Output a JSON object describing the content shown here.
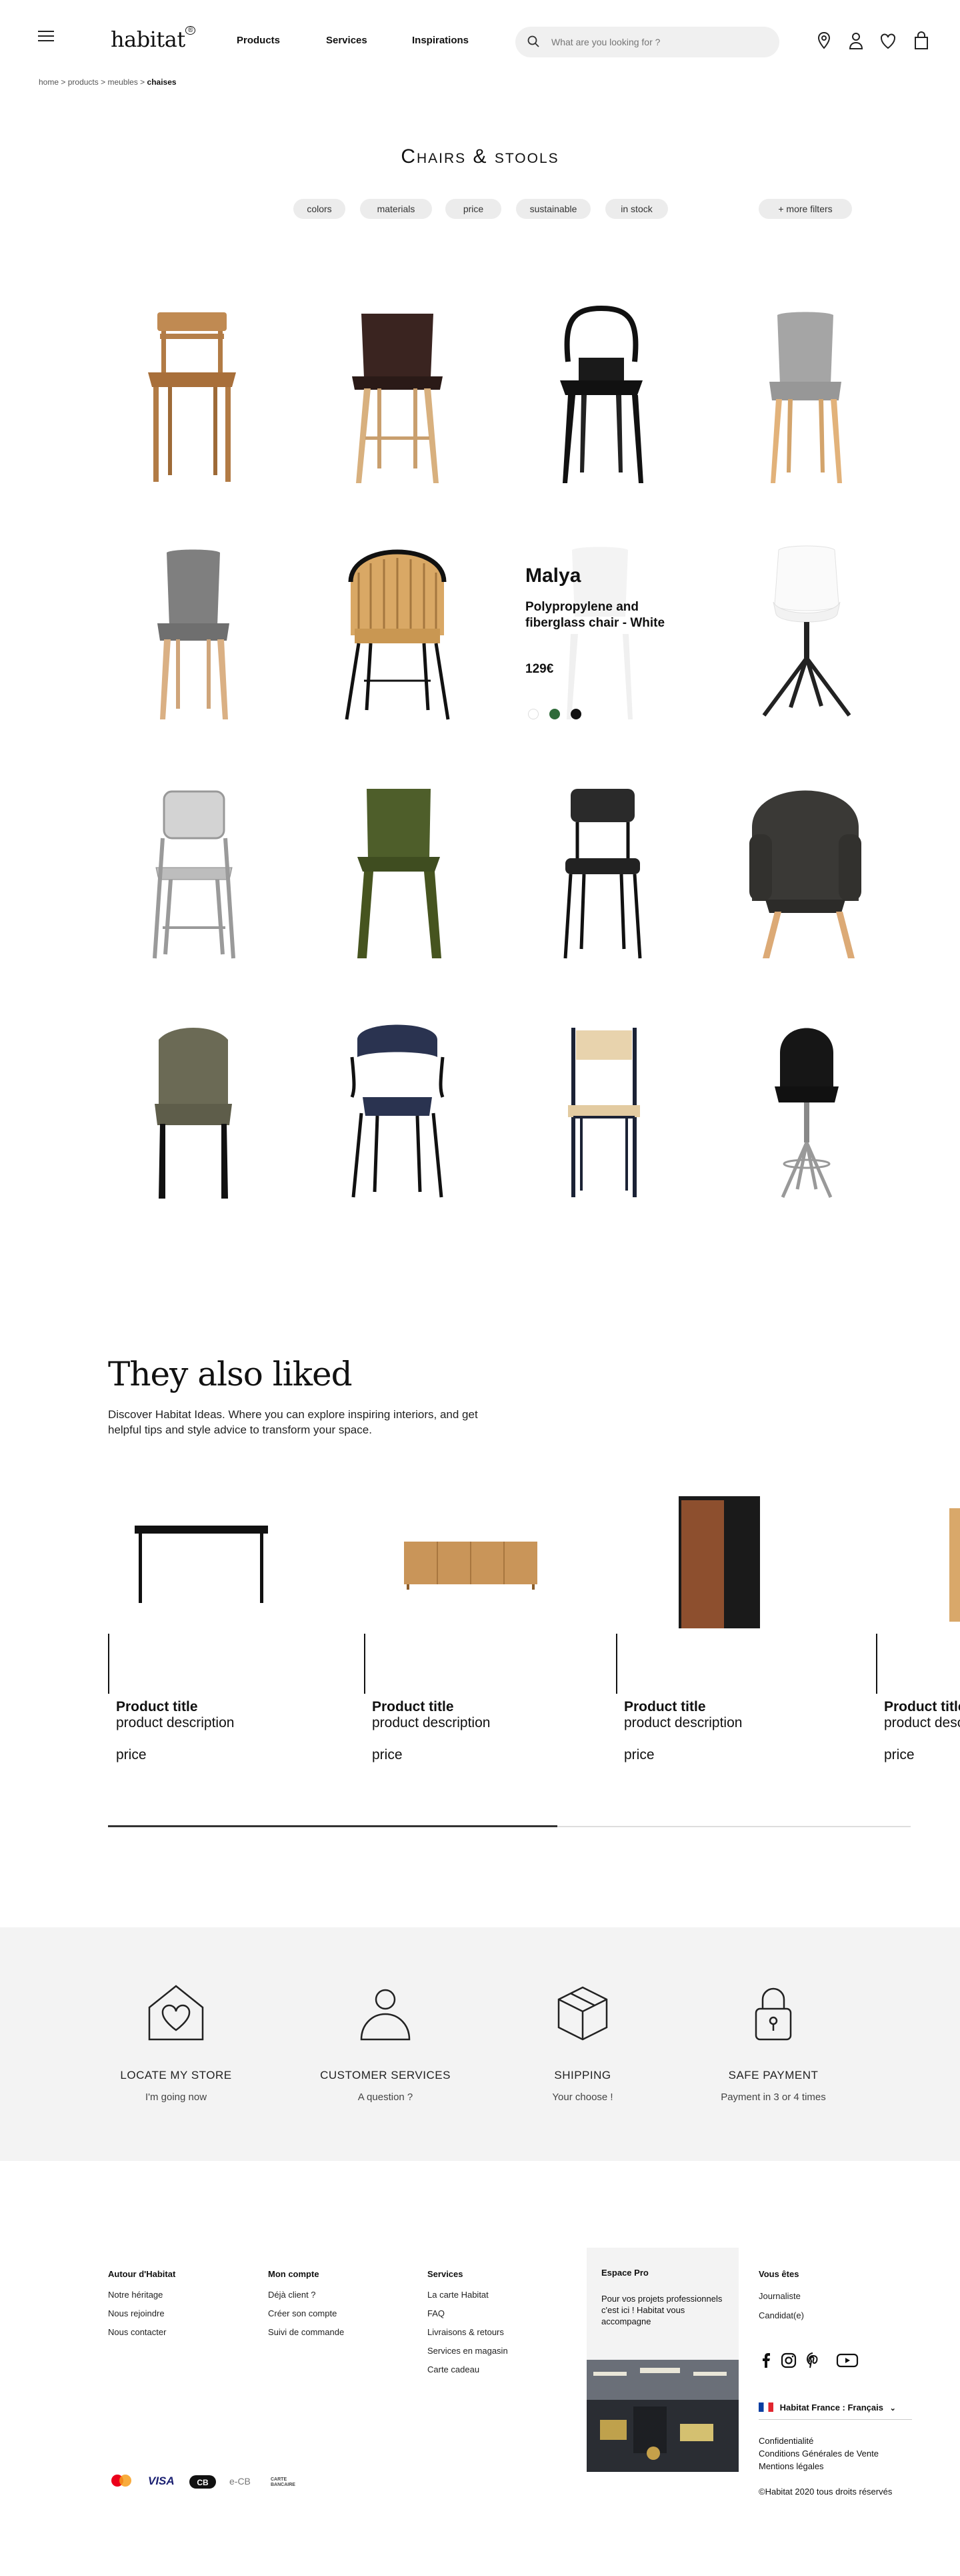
{
  "header": {
    "logo": "habitat",
    "logo_mark": "®",
    "nav": [
      "Products",
      "Services",
      "Inspirations"
    ],
    "search_placeholder": "What are you looking for ?",
    "icons": [
      "store-locator-icon",
      "account-icon",
      "wishlist-heart-icon",
      "bag-icon"
    ]
  },
  "breadcrumb": {
    "items": [
      "home",
      "products",
      "meubles"
    ],
    "current": "chaises",
    "separator": ">"
  },
  "page": {
    "title": "Chairs & stools"
  },
  "filters": [
    "colors",
    "materials",
    "price",
    "sustainable",
    "in stock",
    "+ more filters"
  ],
  "featured": {
    "name": "Malya",
    "description": "Polypropylene and fiberglass chair - White",
    "price": "129€",
    "swatches": [
      "#ffffff",
      "#2f6b3a",
      "#111111"
    ]
  },
  "also_liked": {
    "title": "They also liked",
    "description": "Discover Habitat Ideas. Where you can explore inspiring interiors, and get helpful tips and style advice to transform your space.",
    "cards": [
      {
        "title": "Product title",
        "description": "product description",
        "price": "price"
      },
      {
        "title": "Product title",
        "description": "product description",
        "price": "price"
      },
      {
        "title": "Product title",
        "description": "product description",
        "price": "price"
      },
      {
        "title": "Product title",
        "description": "product description",
        "price": "price"
      }
    ],
    "scroll_progress": 0.56
  },
  "services": [
    {
      "icon": "house-heart-icon",
      "title": "LOCATE MY STORE",
      "subtitle": "I'm going now"
    },
    {
      "icon": "person-icon",
      "title": "CUSTOMER SERVICES",
      "subtitle": "A question ?"
    },
    {
      "icon": "box-icon",
      "title": "SHIPPING",
      "subtitle": "Your choose !"
    },
    {
      "icon": "padlock-icon",
      "title": "SAFE PAYMENT",
      "subtitle": "Payment in 3 or 4 times"
    }
  ],
  "footer": {
    "columns": [
      {
        "title": "Autour d'Habitat",
        "links": [
          "Notre héritage",
          "Nous rejoindre",
          "Nous contacter"
        ]
      },
      {
        "title": "Mon compte",
        "links": [
          "Déjà client ?",
          "Créer son compte",
          "Suivi de commande"
        ]
      },
      {
        "title": "Services",
        "links": [
          "La carte Habitat",
          "FAQ",
          "Livraisons & retours",
          "Services en magasin",
          "Services en magasin",
          "Carte cadeau"
        ]
      }
    ],
    "pro": {
      "title": "Espace Pro",
      "text": "Pour vos projets professionnels c'est ici ! Habitat vous accompagne"
    },
    "vous_etes": {
      "title": "Vous êtes",
      "links": [
        "Journaliste",
        "Candidat(e)"
      ]
    },
    "social": [
      "facebook-icon",
      "instagram-icon",
      "pinterest-icon",
      "youtube-icon"
    ],
    "language": "Habitat France : Français",
    "legal": [
      "Confidentialité",
      "Conditions Générales de Vente",
      "Mentions légales"
    ],
    "copyright": "©Habitat 2020 tous droits réservés",
    "payments": [
      "mastercard",
      "VISA",
      "CB",
      "e-CB",
      "CARTE BANCAIRE"
    ]
  }
}
